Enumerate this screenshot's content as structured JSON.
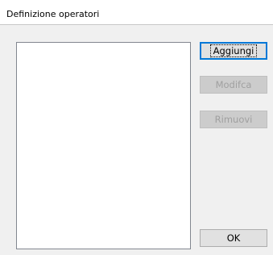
{
  "window": {
    "title": "Definizione operatori"
  },
  "buttons": {
    "add_label": "Aggiungi",
    "edit_label": "Modifca",
    "remove_label": "Rimuovi",
    "ok_label": "OK"
  },
  "operators_list": {
    "items": []
  },
  "colors": {
    "client_background": "#f0f0f0",
    "title_background": "#ffffff",
    "focus_border": "#0078d7",
    "disabled_text": "#a0a0a0"
  }
}
